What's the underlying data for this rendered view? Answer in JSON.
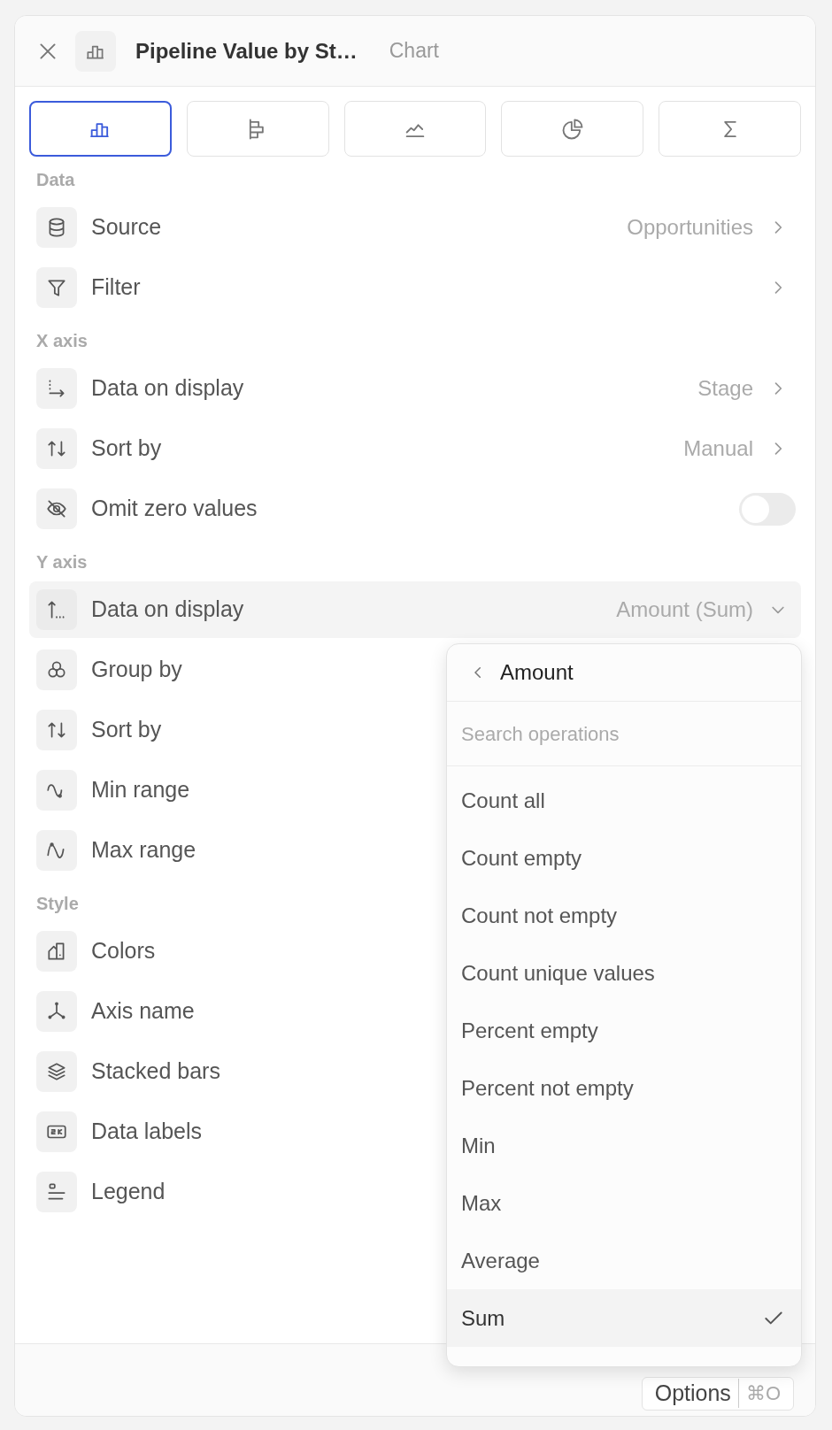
{
  "header": {
    "title": "Pipeline Value by St…",
    "subtitle": "Chart"
  },
  "chart_types": [
    {
      "selected": true
    },
    {
      "selected": false
    },
    {
      "selected": false
    },
    {
      "selected": false
    },
    {
      "selected": false
    }
  ],
  "sections": [
    {
      "title": "Data",
      "rows": [
        {
          "kind": "link",
          "label": "Source",
          "value": "Opportunities"
        },
        {
          "kind": "link",
          "label": "Filter"
        }
      ]
    },
    {
      "title": "X axis",
      "rows": [
        {
          "kind": "link",
          "label": "Data on display",
          "value": "Stage"
        },
        {
          "kind": "link",
          "label": "Sort by",
          "value": "Manual"
        },
        {
          "kind": "toggle",
          "label": "Omit zero values",
          "on": false
        }
      ]
    },
    {
      "title": "Y axis",
      "rows": [
        {
          "kind": "select",
          "label": "Data on display",
          "value": "Amount (Sum)",
          "expanded": true
        },
        {
          "kind": "plain",
          "label": "Group by"
        },
        {
          "kind": "plain",
          "label": "Sort by"
        },
        {
          "kind": "plain",
          "label": "Min range"
        },
        {
          "kind": "plain",
          "label": "Max range"
        }
      ]
    },
    {
      "title": "Style",
      "rows": [
        {
          "kind": "plain",
          "label": "Colors"
        },
        {
          "kind": "plain",
          "label": "Axis name"
        },
        {
          "kind": "plain",
          "label": "Stacked bars"
        },
        {
          "kind": "plain",
          "label": "Data labels"
        },
        {
          "kind": "plain",
          "label": "Legend"
        }
      ]
    }
  ],
  "dropdown": {
    "title": "Amount",
    "search": {
      "placeholder": "Search operations"
    },
    "options": [
      {
        "label": "Count all",
        "selected": false
      },
      {
        "label": "Count empty",
        "selected": false
      },
      {
        "label": "Count not empty",
        "selected": false
      },
      {
        "label": "Count unique values",
        "selected": false
      },
      {
        "label": "Percent empty",
        "selected": false
      },
      {
        "label": "Percent not empty",
        "selected": false
      },
      {
        "label": "Min",
        "selected": false
      },
      {
        "label": "Max",
        "selected": false
      },
      {
        "label": "Average",
        "selected": false
      },
      {
        "label": "Sum",
        "selected": true
      }
    ]
  },
  "footer": {
    "button": "Options",
    "shortcut": "⌘O"
  }
}
